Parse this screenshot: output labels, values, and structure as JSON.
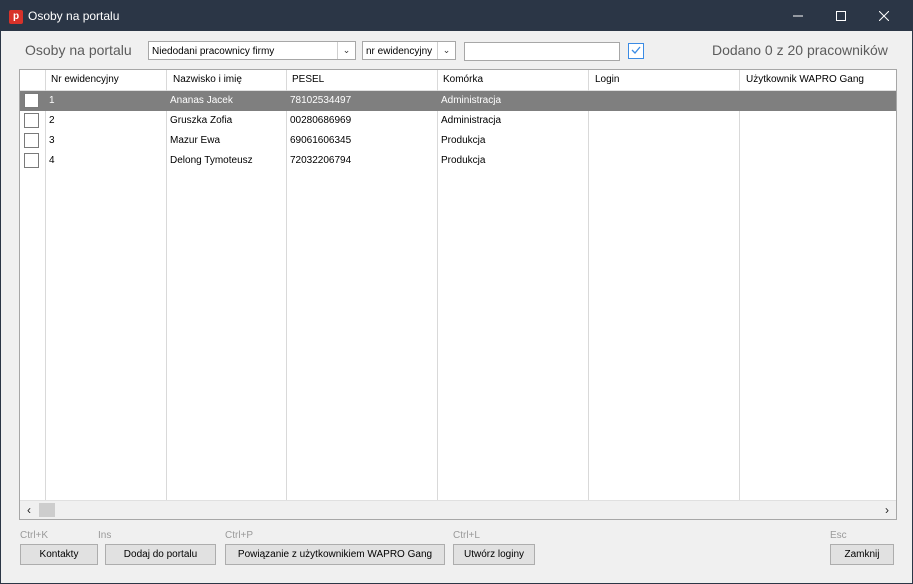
{
  "window": {
    "title": "Osoby na portalu",
    "app_icon_letter": "p"
  },
  "toolbar": {
    "heading": "Osoby na portalu",
    "filter_select": "Niedodani pracownicy firmy",
    "sort_select": "nr ewidencyjny",
    "search_value": "",
    "checkbox_checked": true,
    "status": "Dodano 0 z 20 pracowników"
  },
  "grid": {
    "columns": [
      "Nr ewidencyjny",
      "Nazwisko i imię",
      "PESEL",
      "Komórka",
      "Login",
      "Użytkownik WAPRO Gang"
    ],
    "rows": [
      {
        "nr": "1",
        "name": "Ananas Jacek",
        "pesel": "78102534497",
        "unit": "Administracja",
        "login": "",
        "wapro": "",
        "selected": true
      },
      {
        "nr": "2",
        "name": "Gruszka Zofia",
        "pesel": "00280686969",
        "unit": "Administracja",
        "login": "",
        "wapro": "",
        "selected": false
      },
      {
        "nr": "3",
        "name": "Mazur Ewa",
        "pesel": "69061606345",
        "unit": "Produkcja",
        "login": "",
        "wapro": "",
        "selected": false
      },
      {
        "nr": "4",
        "name": "Delong Tymoteusz",
        "pesel": "72032206794",
        "unit": "Produkcja",
        "login": "",
        "wapro": "",
        "selected": false
      }
    ]
  },
  "footer": {
    "contacts": {
      "shortcut": "Ctrl+K",
      "label": "Kontakty"
    },
    "add": {
      "shortcut": "Ins",
      "label": "Dodaj do portalu"
    },
    "link": {
      "shortcut": "Ctrl+P",
      "label": "Powiązanie z użytkownikiem WAPRO Gang"
    },
    "logins": {
      "shortcut": "Ctrl+L",
      "label": "Utwórz loginy"
    },
    "close": {
      "shortcut": "Esc",
      "label": "Zamknij"
    }
  },
  "colors": {
    "titlebar": "#2b3646",
    "selected_row": "#7f7f7f",
    "accent_check": "#3b8be4"
  }
}
